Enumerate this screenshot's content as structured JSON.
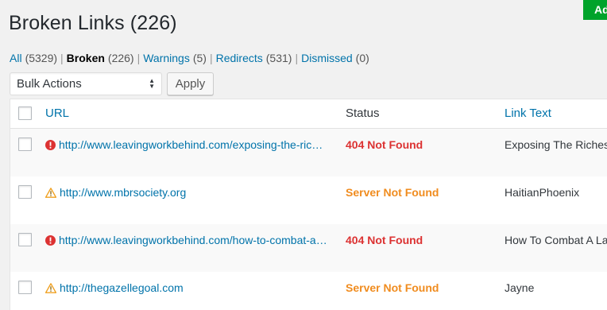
{
  "top_button": {
    "label": "Ad"
  },
  "title": "Broken Links (226)",
  "filters": [
    {
      "label": "All",
      "count": "(5329)",
      "current": false
    },
    {
      "label": "Broken",
      "count": "(226)",
      "current": true
    },
    {
      "label": "Warnings",
      "count": "(5)",
      "current": false
    },
    {
      "label": "Redirects",
      "count": "(531)",
      "current": false
    },
    {
      "label": "Dismissed",
      "count": "(0)",
      "current": false
    }
  ],
  "bulk_actions": {
    "selected": "Bulk Actions"
  },
  "apply_label": "Apply",
  "table": {
    "columns": {
      "url": "URL",
      "status": "Status",
      "link_text": "Link Text"
    },
    "rows": [
      {
        "icon": "error-icon",
        "url": "http://www.leavingworkbehind.com/exposing-the-riches",
        "status": "404 Not Found",
        "status_type": "error",
        "link_text": "Exposing The Riches"
      },
      {
        "icon": "warning-icon",
        "url": "http://www.mbrsociety.org",
        "status": "Server Not Found",
        "status_type": "warning",
        "link_text": "HaitianPhoenix"
      },
      {
        "icon": "error-icon",
        "url": "http://www.leavingworkbehind.com/how-to-combat-a-lack",
        "status": "404 Not Found",
        "status_type": "error",
        "link_text": "How To Combat A Lack"
      },
      {
        "icon": "warning-icon",
        "url": "http://thegazellegoal.com",
        "status": "Server Not Found",
        "status_type": "warning",
        "link_text": "Jayne"
      }
    ]
  },
  "colors": {
    "link": "#0073aa",
    "error": "#dc3232",
    "warning": "#f08c1f",
    "accent_green": "#00a32a"
  }
}
